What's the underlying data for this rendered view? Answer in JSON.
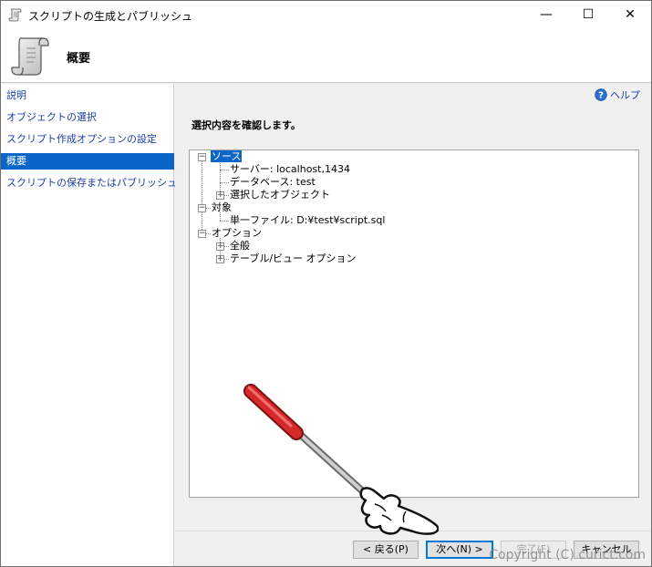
{
  "window": {
    "title": "スクリプトの生成とパブリッシュ",
    "minimize_glyph": "—",
    "maximize_glyph": "☐",
    "close_glyph": "✕"
  },
  "header": {
    "title": "概要",
    "icon": "script-scroll-icon"
  },
  "nav": {
    "items": [
      {
        "label": "説明",
        "selected": false
      },
      {
        "label": "オブジェクトの選択",
        "selected": false
      },
      {
        "label": "スクリプト作成オプションの設定",
        "selected": false
      },
      {
        "label": "概要",
        "selected": true
      },
      {
        "label": "スクリプトの保存またはパブリッシュ",
        "selected": false
      }
    ]
  },
  "main": {
    "help_label": "ヘルプ",
    "heading": "選択内容を確認します。",
    "tree": {
      "source": "ソース",
      "server": "サーバー: localhost,1434",
      "database": "データベース: test",
      "selected_objects": "選択したオブジェクト",
      "target": "対象",
      "single_file": "単一ファイル: D:¥test¥script.sql",
      "options": "オプション",
      "general": "全般",
      "table_view_options": "テーブル/ビュー オプション"
    }
  },
  "footer": {
    "back_label": "< 戻る(P)",
    "next_label": "次へ(N) >",
    "finish_label": "完了(F)",
    "cancel_label": "キャンセル"
  },
  "watermark": "Copyright (C) curict.com",
  "colors": {
    "accent": "#0a67c9",
    "link": "#1c3fa8",
    "pointer_red": "#d62a2a"
  }
}
